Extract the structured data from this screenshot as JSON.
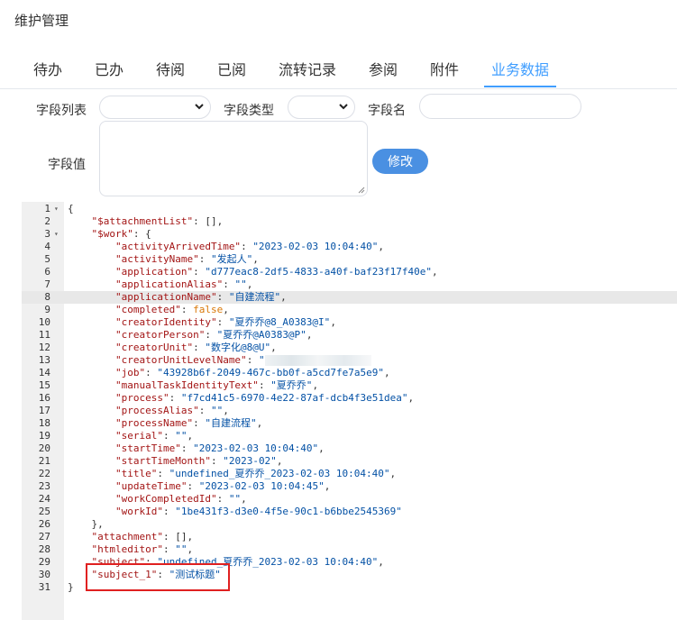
{
  "page": {
    "title": "维护管理"
  },
  "tabs": [
    {
      "label": "待办",
      "active": false
    },
    {
      "label": "已办",
      "active": false
    },
    {
      "label": "待阅",
      "active": false
    },
    {
      "label": "已阅",
      "active": false
    },
    {
      "label": "流转记录",
      "active": false
    },
    {
      "label": "参阅",
      "active": false
    },
    {
      "label": "附件",
      "active": false
    },
    {
      "label": "业务数据",
      "active": true
    }
  ],
  "form": {
    "field_list_label": "字段列表",
    "field_type_label": "字段类型",
    "field_name_label": "字段名",
    "field_value_label": "字段值",
    "field_list_value": "",
    "field_type_value": "",
    "field_name_value": "",
    "field_value_value": "",
    "modify_button": "修改"
  },
  "colors": {
    "accent": "#409eff",
    "button": "#4a90e2",
    "highlight_box": "#e02020"
  },
  "editor": {
    "highlighted_line": 8,
    "lines": [
      {
        "n": "1",
        "fold": "▾",
        "code": [
          [
            "p",
            "{"
          ]
        ]
      },
      {
        "n": "2",
        "fold": "",
        "code": [
          [
            "p",
            "    "
          ],
          [
            "k",
            "\"$attachmentList\""
          ],
          [
            "p",
            ": [],"
          ]
        ]
      },
      {
        "n": "3",
        "fold": "▾",
        "code": [
          [
            "p",
            "    "
          ],
          [
            "k",
            "\"$work\""
          ],
          [
            "p",
            ": {"
          ]
        ]
      },
      {
        "n": "4",
        "fold": "",
        "code": [
          [
            "p",
            "        "
          ],
          [
            "k",
            "\"activityArrivedTime\""
          ],
          [
            "p",
            ": "
          ],
          [
            "s",
            "\"2023-02-03 10:04:40\""
          ],
          [
            "p",
            ","
          ]
        ]
      },
      {
        "n": "5",
        "fold": "",
        "code": [
          [
            "p",
            "        "
          ],
          [
            "k",
            "\"activityName\""
          ],
          [
            "p",
            ": "
          ],
          [
            "s",
            "\"发起人\""
          ],
          [
            "p",
            ","
          ]
        ]
      },
      {
        "n": "6",
        "fold": "",
        "code": [
          [
            "p",
            "        "
          ],
          [
            "k",
            "\"application\""
          ],
          [
            "p",
            ": "
          ],
          [
            "s",
            "\"d777eac8-2df5-4833-a40f-baf23f17f40e\""
          ],
          [
            "p",
            ","
          ]
        ]
      },
      {
        "n": "7",
        "fold": "",
        "code": [
          [
            "p",
            "        "
          ],
          [
            "k",
            "\"applicationAlias\""
          ],
          [
            "p",
            ": "
          ],
          [
            "s",
            "\"\""
          ],
          [
            "p",
            ","
          ]
        ]
      },
      {
        "n": "8",
        "fold": "",
        "code": [
          [
            "p",
            "        "
          ],
          [
            "k",
            "\"applicationName\""
          ],
          [
            "p",
            ": "
          ],
          [
            "s",
            "\"自建流程\""
          ],
          [
            "p",
            ","
          ]
        ]
      },
      {
        "n": "9",
        "fold": "",
        "code": [
          [
            "p",
            "        "
          ],
          [
            "k",
            "\"completed\""
          ],
          [
            "p",
            ": "
          ],
          [
            "c",
            "false"
          ],
          [
            "p",
            ","
          ]
        ]
      },
      {
        "n": "10",
        "fold": "",
        "code": [
          [
            "p",
            "        "
          ],
          [
            "k",
            "\"creatorIdentity\""
          ],
          [
            "p",
            ": "
          ],
          [
            "s",
            "\"夏乔乔@8_A0383@I\""
          ],
          [
            "p",
            ","
          ]
        ]
      },
      {
        "n": "11",
        "fold": "",
        "code": [
          [
            "p",
            "        "
          ],
          [
            "k",
            "\"creatorPerson\""
          ],
          [
            "p",
            ": "
          ],
          [
            "s",
            "\"夏乔乔@A0383@P\""
          ],
          [
            "p",
            ","
          ]
        ]
      },
      {
        "n": "12",
        "fold": "",
        "code": [
          [
            "p",
            "        "
          ],
          [
            "k",
            "\"creatorUnit\""
          ],
          [
            "p",
            ": "
          ],
          [
            "s",
            "\"数字化@8@U\""
          ],
          [
            "p",
            ","
          ]
        ]
      },
      {
        "n": "13",
        "fold": "",
        "code": [
          [
            "p",
            "        "
          ],
          [
            "k",
            "\"creatorUnitLevelName\""
          ],
          [
            "p",
            ": "
          ],
          [
            "s",
            "\""
          ],
          [
            "blur",
            ""
          ]
        ]
      },
      {
        "n": "14",
        "fold": "",
        "code": [
          [
            "p",
            "        "
          ],
          [
            "k",
            "\"job\""
          ],
          [
            "p",
            ": "
          ],
          [
            "s",
            "\"43928b6f-2049-467c-bb0f-a5cd7fe7a5e9\""
          ],
          [
            "p",
            ","
          ]
        ]
      },
      {
        "n": "15",
        "fold": "",
        "code": [
          [
            "p",
            "        "
          ],
          [
            "k",
            "\"manualTaskIdentityText\""
          ],
          [
            "p",
            ": "
          ],
          [
            "s",
            "\"夏乔乔\""
          ],
          [
            "p",
            ","
          ]
        ]
      },
      {
        "n": "16",
        "fold": "",
        "code": [
          [
            "p",
            "        "
          ],
          [
            "k",
            "\"process\""
          ],
          [
            "p",
            ": "
          ],
          [
            "s",
            "\"f7cd41c5-6970-4e22-87af-dcb4f3e51dea\""
          ],
          [
            "p",
            ","
          ]
        ]
      },
      {
        "n": "17",
        "fold": "",
        "code": [
          [
            "p",
            "        "
          ],
          [
            "k",
            "\"processAlias\""
          ],
          [
            "p",
            ": "
          ],
          [
            "s",
            "\"\""
          ],
          [
            "p",
            ","
          ]
        ]
      },
      {
        "n": "18",
        "fold": "",
        "code": [
          [
            "p",
            "        "
          ],
          [
            "k",
            "\"processName\""
          ],
          [
            "p",
            ": "
          ],
          [
            "s",
            "\"自建流程\""
          ],
          [
            "p",
            ","
          ]
        ]
      },
      {
        "n": "19",
        "fold": "",
        "code": [
          [
            "p",
            "        "
          ],
          [
            "k",
            "\"serial\""
          ],
          [
            "p",
            ": "
          ],
          [
            "s",
            "\"\""
          ],
          [
            "p",
            ","
          ]
        ]
      },
      {
        "n": "20",
        "fold": "",
        "code": [
          [
            "p",
            "        "
          ],
          [
            "k",
            "\"startTime\""
          ],
          [
            "p",
            ": "
          ],
          [
            "s",
            "\"2023-02-03 10:04:40\""
          ],
          [
            "p",
            ","
          ]
        ]
      },
      {
        "n": "21",
        "fold": "",
        "code": [
          [
            "p",
            "        "
          ],
          [
            "k",
            "\"startTimeMonth\""
          ],
          [
            "p",
            ": "
          ],
          [
            "s",
            "\"2023-02\""
          ],
          [
            "p",
            ","
          ]
        ]
      },
      {
        "n": "22",
        "fold": "",
        "code": [
          [
            "p",
            "        "
          ],
          [
            "k",
            "\"title\""
          ],
          [
            "p",
            ": "
          ],
          [
            "s",
            "\"undefined_夏乔乔_2023-02-03 10:04:40\""
          ],
          [
            "p",
            ","
          ]
        ]
      },
      {
        "n": "23",
        "fold": "",
        "code": [
          [
            "p",
            "        "
          ],
          [
            "k",
            "\"updateTime\""
          ],
          [
            "p",
            ": "
          ],
          [
            "s",
            "\"2023-02-03 10:04:45\""
          ],
          [
            "p",
            ","
          ]
        ]
      },
      {
        "n": "24",
        "fold": "",
        "code": [
          [
            "p",
            "        "
          ],
          [
            "k",
            "\"workCompletedId\""
          ],
          [
            "p",
            ": "
          ],
          [
            "s",
            "\"\""
          ],
          [
            "p",
            ","
          ]
        ]
      },
      {
        "n": "25",
        "fold": "",
        "code": [
          [
            "p",
            "        "
          ],
          [
            "k",
            "\"workId\""
          ],
          [
            "p",
            ": "
          ],
          [
            "s",
            "\"1be431f3-d3e0-4f5e-90c1-b6bbe2545369\""
          ]
        ]
      },
      {
        "n": "26",
        "fold": "",
        "code": [
          [
            "p",
            "    },"
          ]
        ]
      },
      {
        "n": "27",
        "fold": "",
        "code": [
          [
            "p",
            "    "
          ],
          [
            "k",
            "\"attachment\""
          ],
          [
            "p",
            ": [],"
          ]
        ]
      },
      {
        "n": "28",
        "fold": "",
        "code": [
          [
            "p",
            "    "
          ],
          [
            "k",
            "\"htmleditor\""
          ],
          [
            "p",
            ": "
          ],
          [
            "s",
            "\"\""
          ],
          [
            "p",
            ","
          ]
        ]
      },
      {
        "n": "29",
        "fold": "",
        "code": [
          [
            "p",
            "    "
          ],
          [
            "k",
            "\"subject\""
          ],
          [
            "p",
            ": "
          ],
          [
            "s",
            "\"undefined_夏乔乔_2023-02-03 10:04:40\""
          ],
          [
            "p",
            ","
          ]
        ]
      },
      {
        "n": "30",
        "fold": "",
        "code": [
          [
            "p",
            "    "
          ],
          [
            "k",
            "\"subject_1\""
          ],
          [
            "p",
            ": "
          ],
          [
            "s",
            "\"测试标题\""
          ]
        ]
      },
      {
        "n": "31",
        "fold": "",
        "code": [
          [
            "p",
            "}"
          ]
        ]
      }
    ]
  }
}
